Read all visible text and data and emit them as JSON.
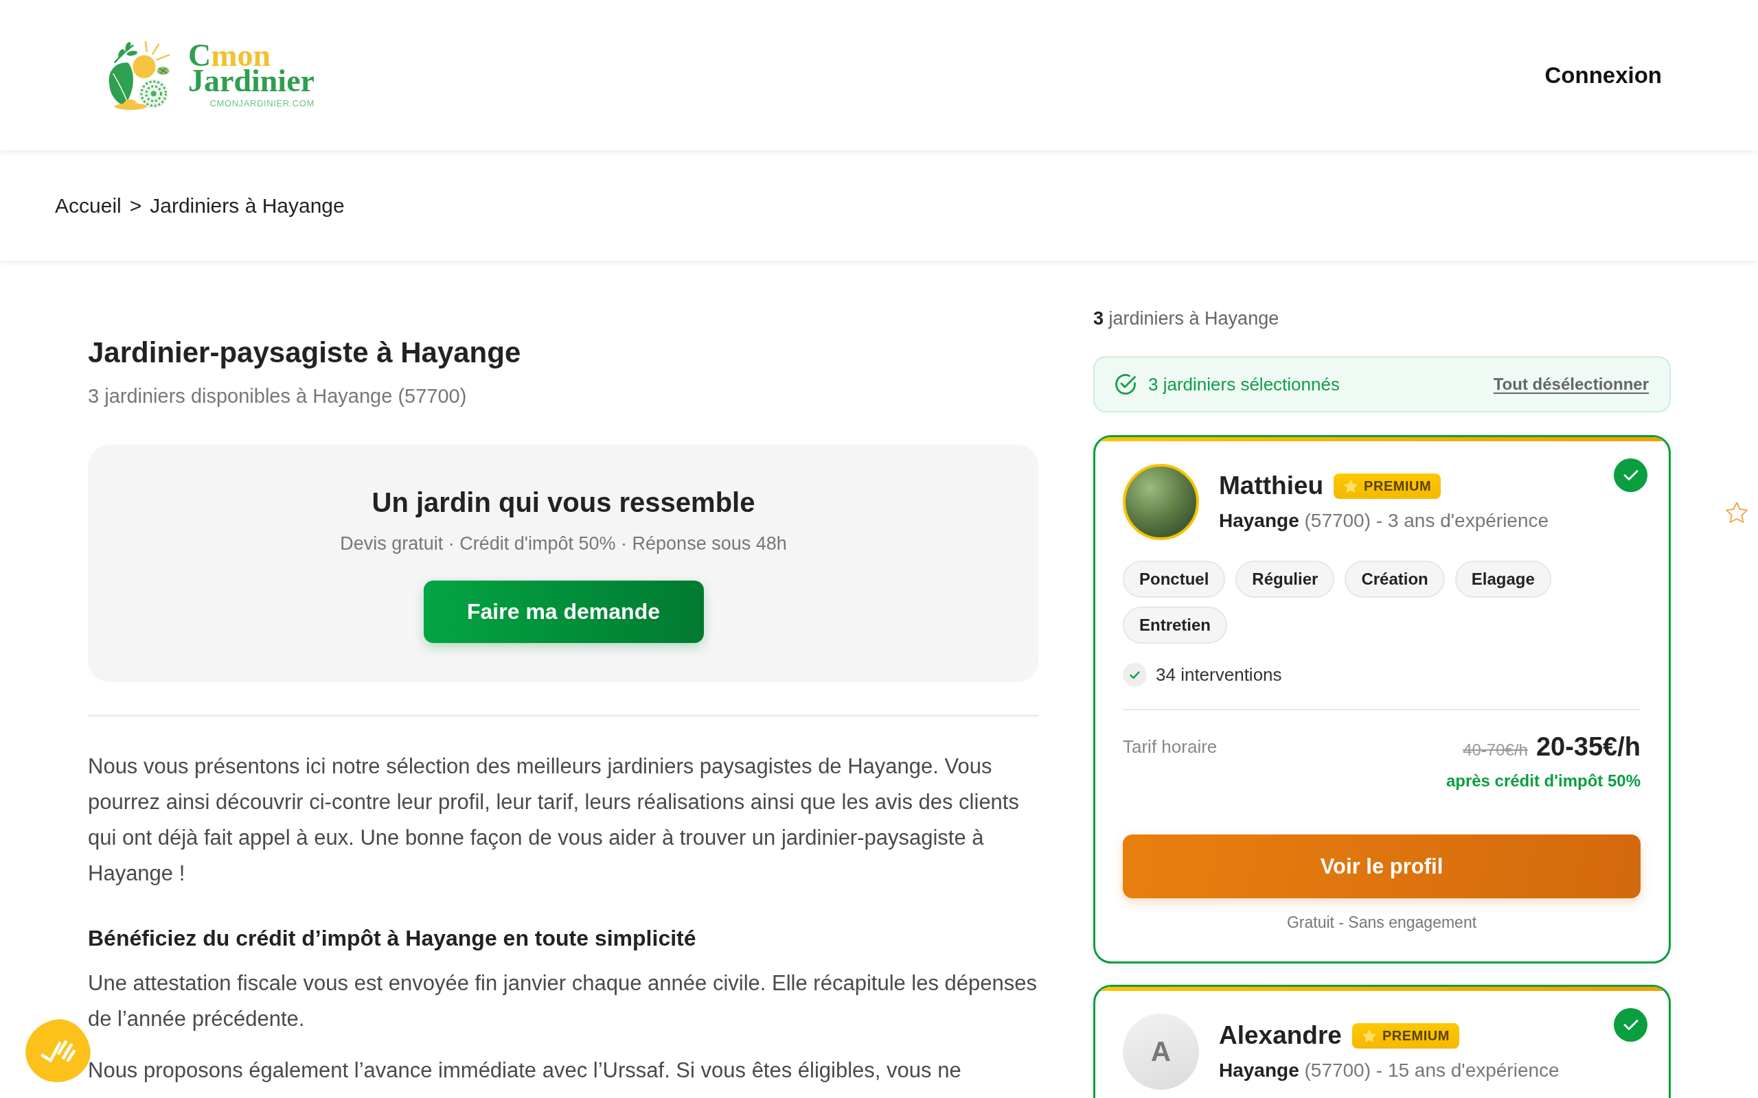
{
  "header": {
    "logo": {
      "wordmark": [
        "Cmon",
        "Jardinier"
      ],
      "domain": "CMONJARDINIER.COM"
    },
    "login": "Connexion"
  },
  "breadcrumb": {
    "items": [
      "Accueil",
      "Jardiniers à Hayange"
    ],
    "separator": ">"
  },
  "intro": {
    "title": "Jardinier-paysagiste à Hayange",
    "subtitle": "3 jardiniers disponibles à Hayange (57700)"
  },
  "cta": {
    "title": "Un jardin qui vous ressemble",
    "perks": "Devis gratuit · Crédit d'impôt 50% · Réponse sous 48h",
    "button": "Faire ma demande"
  },
  "content": [
    {
      "kind": "paragraph",
      "text": "Nous vous présentons ici notre sélection des meilleurs jardiniers paysagistes de Hayange. Vous pourrez ainsi découvrir ci-contre leur profil, leur tarif, leurs réalisations ainsi que les avis des clients qui ont déjà fait appel à eux. Une bonne façon de vous aider à trouver un jardinier-paysagiste à Hayange !"
    },
    {
      "kind": "heading",
      "text": "Bénéficiez du crédit d’impôt à Hayange en toute simplicité"
    },
    {
      "kind": "paragraph",
      "text": "Une attestation fiscale vous est envoyée fin janvier chaque année civile. Elle récapitule les dépenses de l’année précédente."
    },
    {
      "kind": "paragraph",
      "text": "Nous proposons également l’avance immédiate avec l’Urssaf. Si vous êtes éligibles, vous ne"
    }
  ],
  "results": {
    "count": "**3** jardiniers à Hayange",
    "selection": {
      "label": "3 jardiniers sélectionnés",
      "action": "Tout désélectionner"
    },
    "gardeners": [
      {
        "name": "Matthieu",
        "badge": "PREMIUM",
        "selected": true,
        "avatar": {
          "kind": "photo"
        },
        "location": "**Hayange** (57700) - 3 ans d'expérience",
        "services": [
          "Ponctuel",
          "Régulier",
          "Création",
          "Elagage",
          "Entretien"
        ],
        "interventions": "34 interventions",
        "rate_label": "Tarif horaire",
        "old_rate": "40-70€/h",
        "rate": "20-35€/h",
        "rate_note": "après crédit d'impôt 50%",
        "button": "Voir le profil",
        "button_note": "Gratuit - Sans engagement"
      },
      {
        "name": "Alexandre",
        "badge": "PREMIUM",
        "selected": true,
        "avatar": {
          "kind": "initial",
          "initial": "A"
        },
        "location": "**Hayange** (57700) - 15 ans d'expérience"
      }
    ]
  }
}
